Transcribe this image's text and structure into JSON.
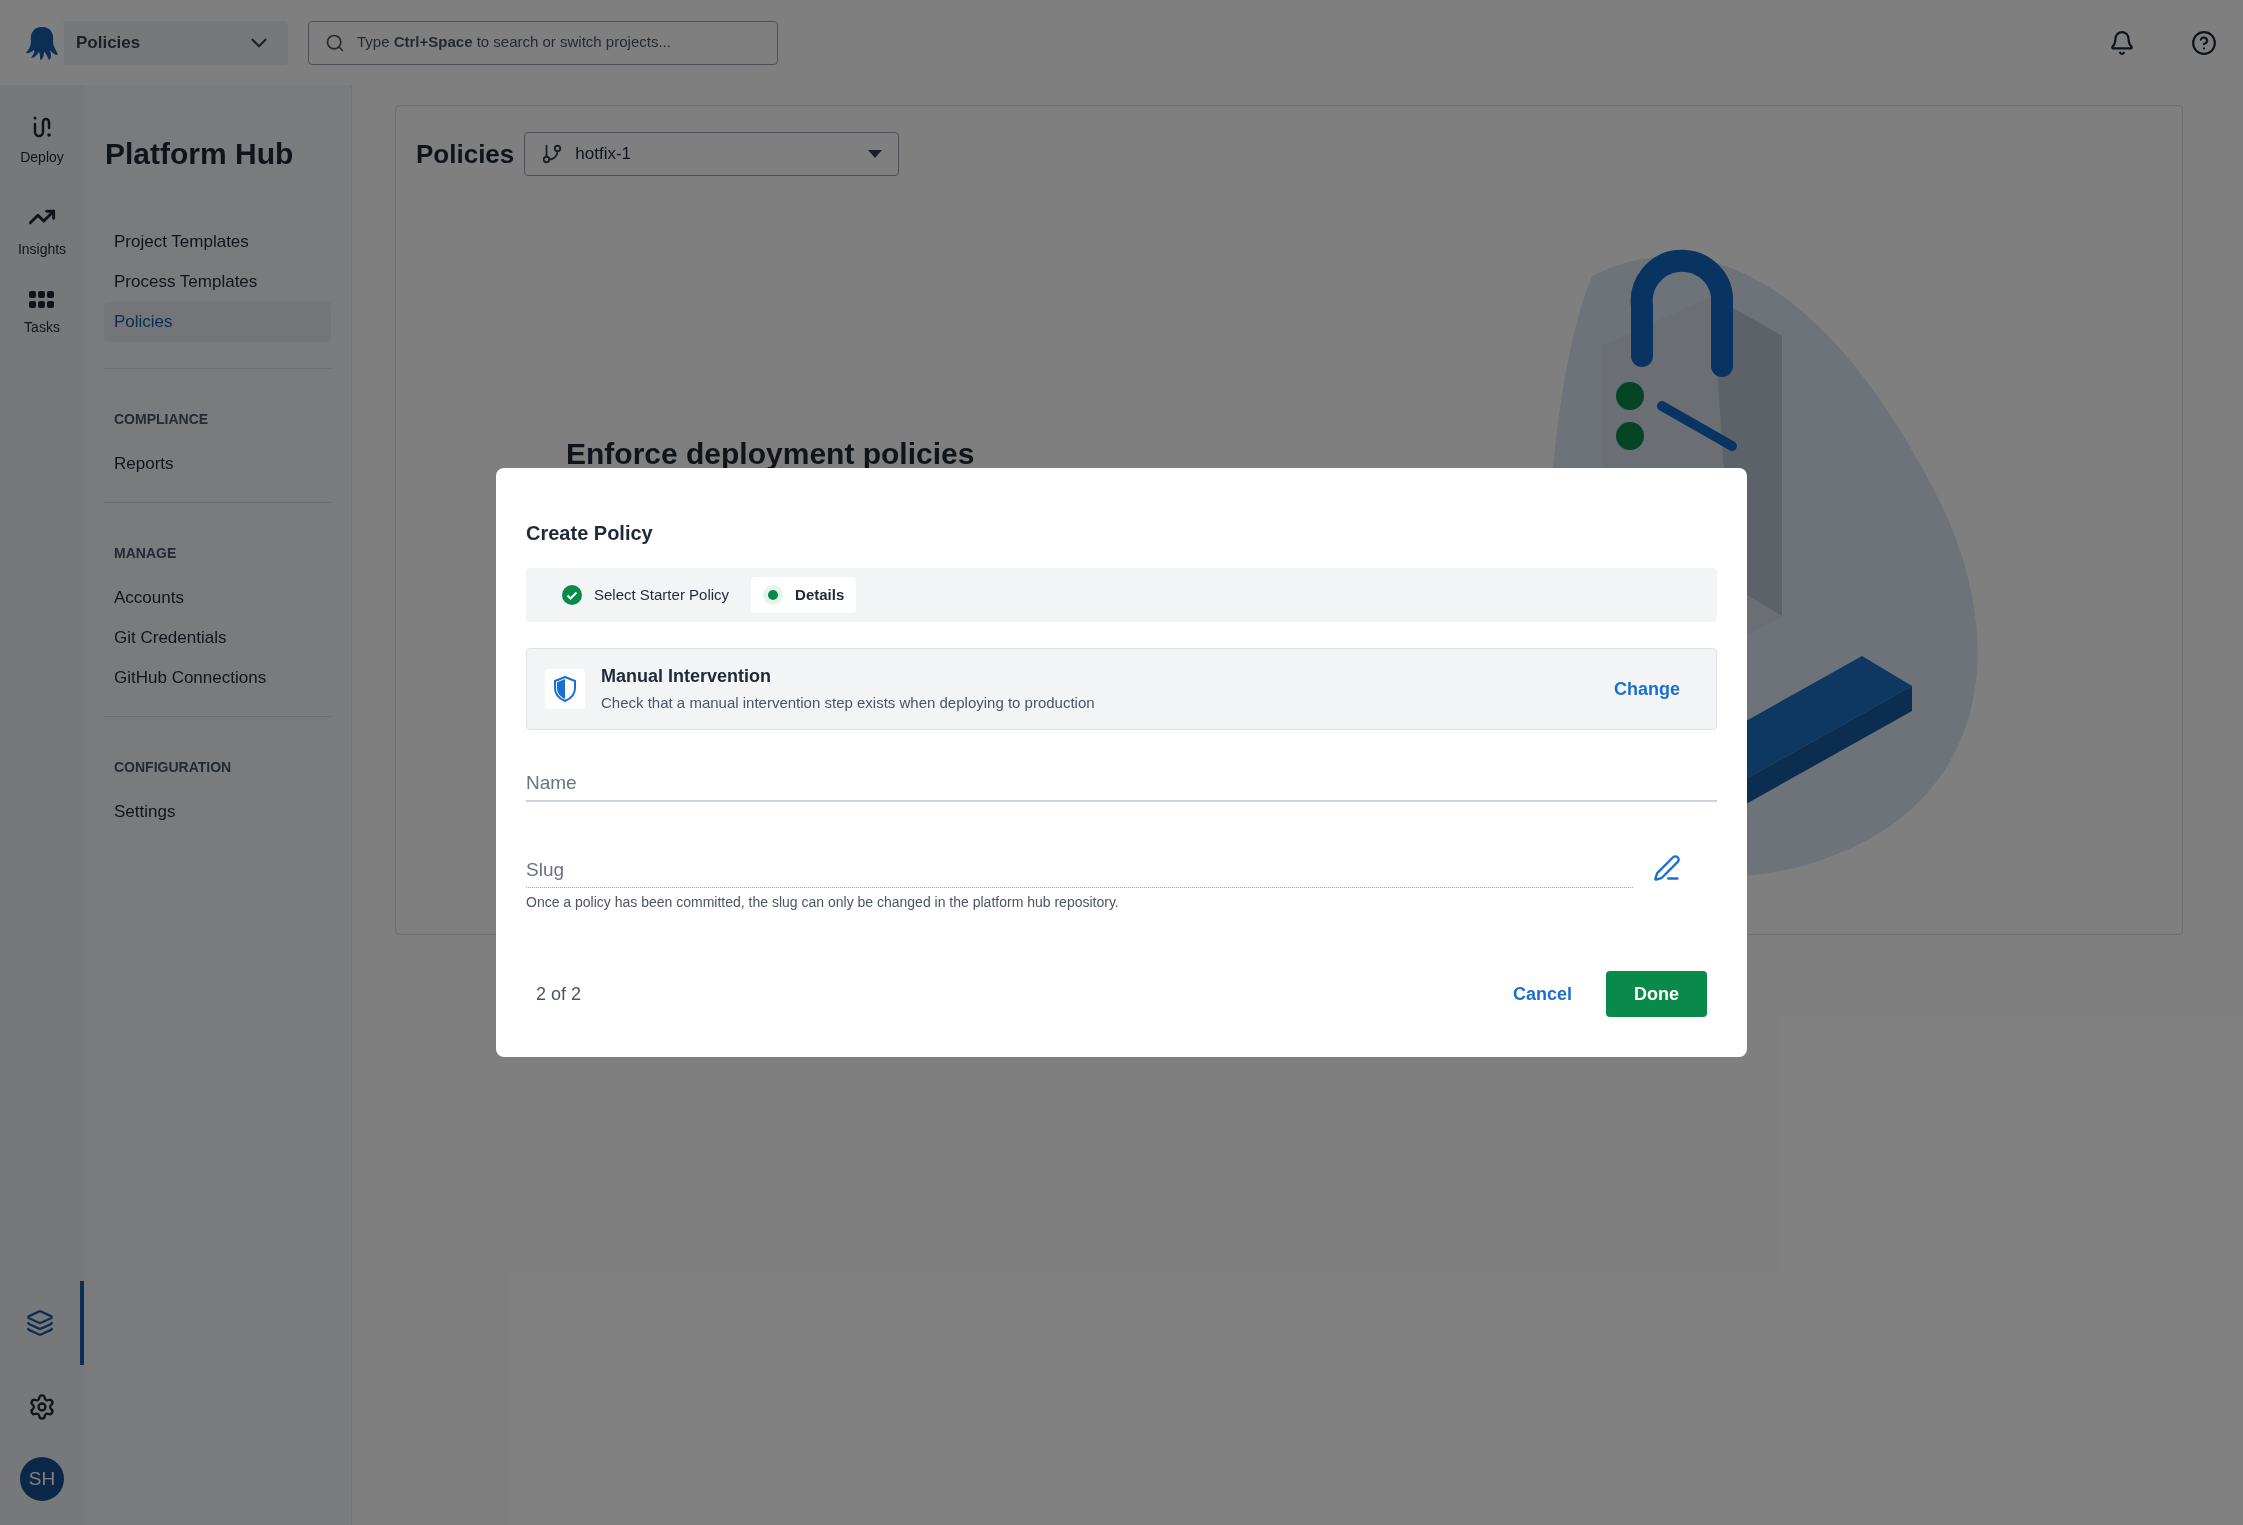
{
  "topbar": {
    "project": "Policies",
    "search": {
      "placeholder": "Type **Ctrl+Space** to search or switch projects..."
    }
  },
  "rail": {
    "items": [
      {
        "label": "Deploy",
        "kind": "deploy"
      },
      {
        "label": "Insights",
        "kind": "insights"
      },
      {
        "label": "Tasks",
        "kind": "tasks"
      }
    ],
    "bottom": [
      {
        "kind": "layers",
        "selected": true
      },
      {
        "kind": "settings",
        "selected": false
      }
    ],
    "avatar": "SH"
  },
  "sidebar": {
    "title": "Platform Hub",
    "sections": [
      {
        "items": [
          {
            "label": "Project Templates",
            "selected": false
          },
          {
            "label": "Process Templates",
            "selected": false
          },
          {
            "label": "Policies",
            "selected": true
          }
        ]
      },
      {
        "heading": "COMPLIANCE",
        "items": [
          {
            "label": "Reports",
            "selected": false
          }
        ]
      },
      {
        "heading": "MANAGE",
        "items": [
          {
            "label": "Accounts",
            "selected": false
          },
          {
            "label": "Git Credentials",
            "selected": false
          },
          {
            "label": "GitHub Connections",
            "selected": false
          }
        ]
      },
      {
        "heading": "CONFIGURATION",
        "items": [
          {
            "label": "Settings",
            "selected": false
          }
        ]
      }
    ]
  },
  "main": {
    "title": "Policies",
    "branch": "hotfix-1",
    "heading": "Enforce deployment policies"
  },
  "modal": {
    "title": "Create Policy",
    "steps": [
      {
        "label": "Select Starter Policy",
        "kind": "done",
        "selected": false
      },
      {
        "label": "Details",
        "kind": "current",
        "selected": true
      }
    ],
    "policy": {
      "title": "Manual Intervention",
      "description": "Check that a manual intervention step exists when deploying to production",
      "action": "Change"
    },
    "name_field": {
      "placeholder": "Name"
    },
    "slug_field": {
      "placeholder": "Slug",
      "help": "Once a policy has been committed, the slug can only be changed in the platform hub repository."
    },
    "progress": "2 of 2",
    "buttons": [
      {
        "label": "Cancel",
        "kind": "secondary"
      },
      {
        "label": "Done",
        "kind": "primary"
      }
    ]
  }
}
